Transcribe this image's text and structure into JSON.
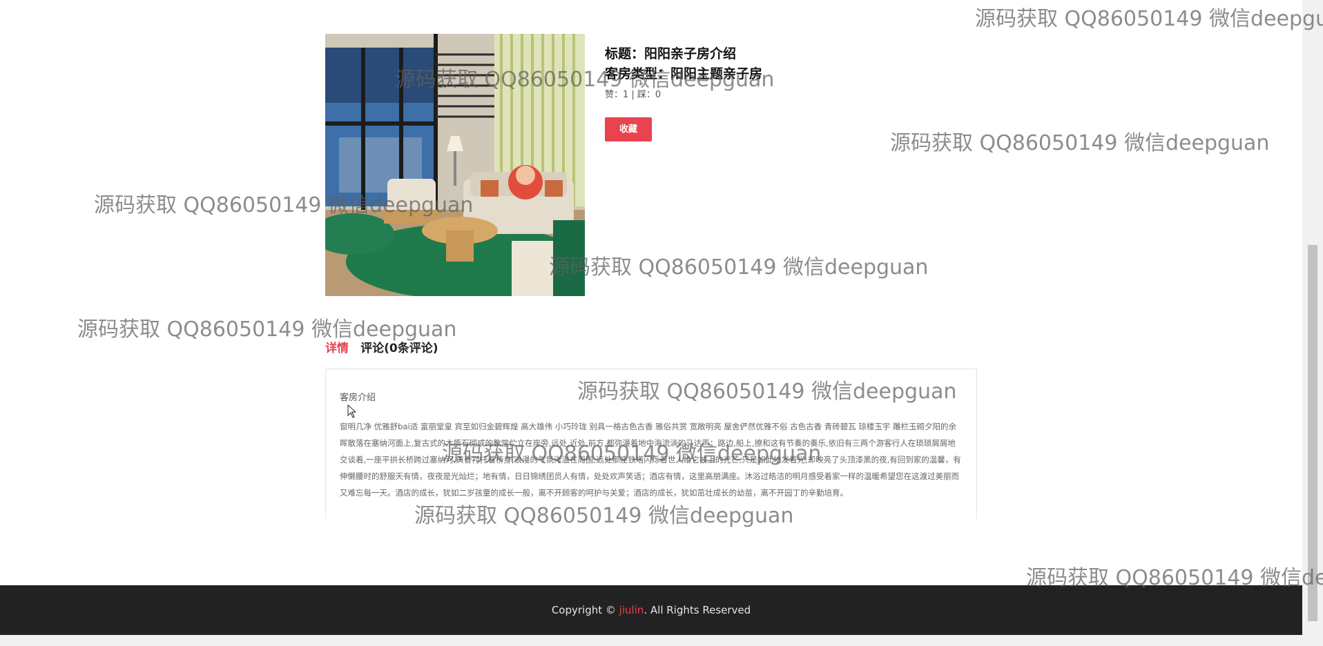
{
  "room": {
    "title": "标题：阳阳亲子房介绍",
    "room_type": "客房类型：阳阳主题亲子房",
    "votes": "赞：1 | 踩：0",
    "collect_label": "收藏"
  },
  "tabs": [
    {
      "label": "详情",
      "active": true
    },
    {
      "label": "评论(0条评论)",
      "active": false
    }
  ],
  "details": {
    "heading": "客房介绍",
    "body": "窗明几净 优雅舒bai适 富丽堂皇 宾至如归金碧辉煌 高大雄伟 小巧玲珑 别具一格古色古香 雅俗共赏 宽敞明亮 屋舍俨然优雅不俗 古色古香 青砖碧瓦 琼楼玉宇 雕栏玉砌夕阳的余晖散落在塞纳河面上,复古式的木质石砌成的教堂伫立在岸旁,远处,近处,前方,都弥漫着地中海流淌的马达声；路边,船上,撩和这有节奏的奏乐,依旧有三两个游客行人在琐琐屑屑地交谈着,一座平拱长桥跨过塞纳河,黄昏衬托着桥身,浪漫的气氛洋溢在周围;远处那座铁塔闪烁着世人给它披上的光芒,只是如此地发着光,却映亮了头顶漆黑的夜,有回到家的温馨，有伸懒腰时的舒服天有情，夜夜是光灿烂；地有情，日日锦绣团员人有情，处处欢声笑语；酒店有情，这里高朋满座。沐浴过皓洁的明月感受着家一样的温暖希望您在这渡过美丽而又难忘每一天。酒店的成长，犹如二岁孩童的成长一般，离不开顾客的呵护与关爱；酒店的成长，犹如茁壮成长的幼苗，离不开园丁的辛勤培育。"
  },
  "footer": {
    "prefix": "Copyright © ",
    "brand": "jiulin",
    "suffix": ". All Rights Reserved"
  },
  "watermark": "源码获取 QQ86050149 微信deepguan",
  "colors": {
    "accent": "#e8434f",
    "footer_bg": "#222222"
  }
}
